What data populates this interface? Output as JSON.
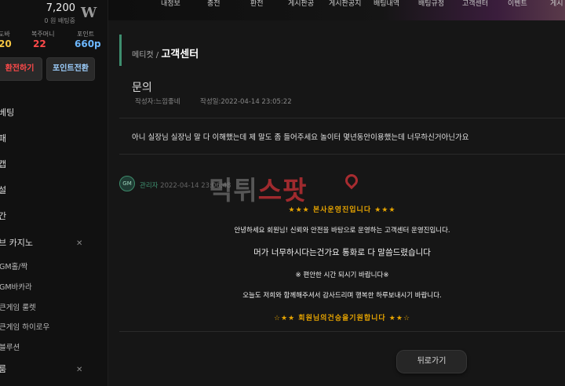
{
  "sidebar": {
    "balance": "7,200",
    "balance_sub": "0 원 배팅중",
    "logo": "W",
    "stats": [
      {
        "label": "도바",
        "value": "20",
        "color": "#f5c542"
      },
      {
        "label": "복주머니",
        "value": "22",
        "color": "#ff4a4a"
      },
      {
        "label": "포인트",
        "value": "660p",
        "color": "#6db8ff"
      }
    ],
    "exchange_button": "환전하기",
    "point_button": "포인트전환",
    "menu": [
      "베팅",
      "패",
      "캡",
      "설",
      "간"
    ],
    "casino_section": "브 카지노",
    "casino_items": [
      "GM홀/짝",
      "GM바카라",
      "큰게임 룰렛",
      "큰게임 하이로우",
      "블루션"
    ],
    "last_item": "룸",
    "close_icon": "close-icon"
  },
  "topnav": {
    "items": [
      "내정보",
      "충전",
      "환전",
      "게시판공",
      "게시판공지",
      "배팅내역",
      "배팅규정",
      "고객센터",
      "이벤트",
      "게시"
    ]
  },
  "breadcrumb": {
    "parent": "메티컷 /",
    "current": "고객센터"
  },
  "post": {
    "title": "문의",
    "author_label": "작성자:",
    "author": "느낌좋네",
    "date_label": "작성일:",
    "date": "2022-04-14 23:05:22",
    "question": "아니 실장님 실장님 말 다 이해했는데 제 말도 좀 들어주세요 놀이터 몇년동안이용했는데 너무하신거아닌가요"
  },
  "reply": {
    "badge": "GM",
    "author": "관리자",
    "date": "2022-04-14 23:06:48",
    "lines": [
      "★★★ 본사운영진입니다 ★★★",
      "안녕하세요 회원님! 신뢰와 안전을 바탕으로 운영하는 고객센터 운영진입니다.",
      "머가 너무하시다는건가요 통화로 다 말씀드렸습니다",
      "※ 편안한 시간 되시기 바랍니다※",
      "오늘도 저희와 함께해주셔서 감사드리며 행복한 하루보내시기 바랍니다.",
      "☆★★ 회원님의건승을기원합니다 ★★☆"
    ]
  },
  "watermark": {
    "part1": "먹튀",
    "part2": "스팟"
  },
  "back_button": "뒤로가기",
  "colors": {
    "accent_green": "#3e8e6f",
    "gold": "#e6a400",
    "red": "#ff4a4a",
    "blue": "#6db8ff"
  }
}
